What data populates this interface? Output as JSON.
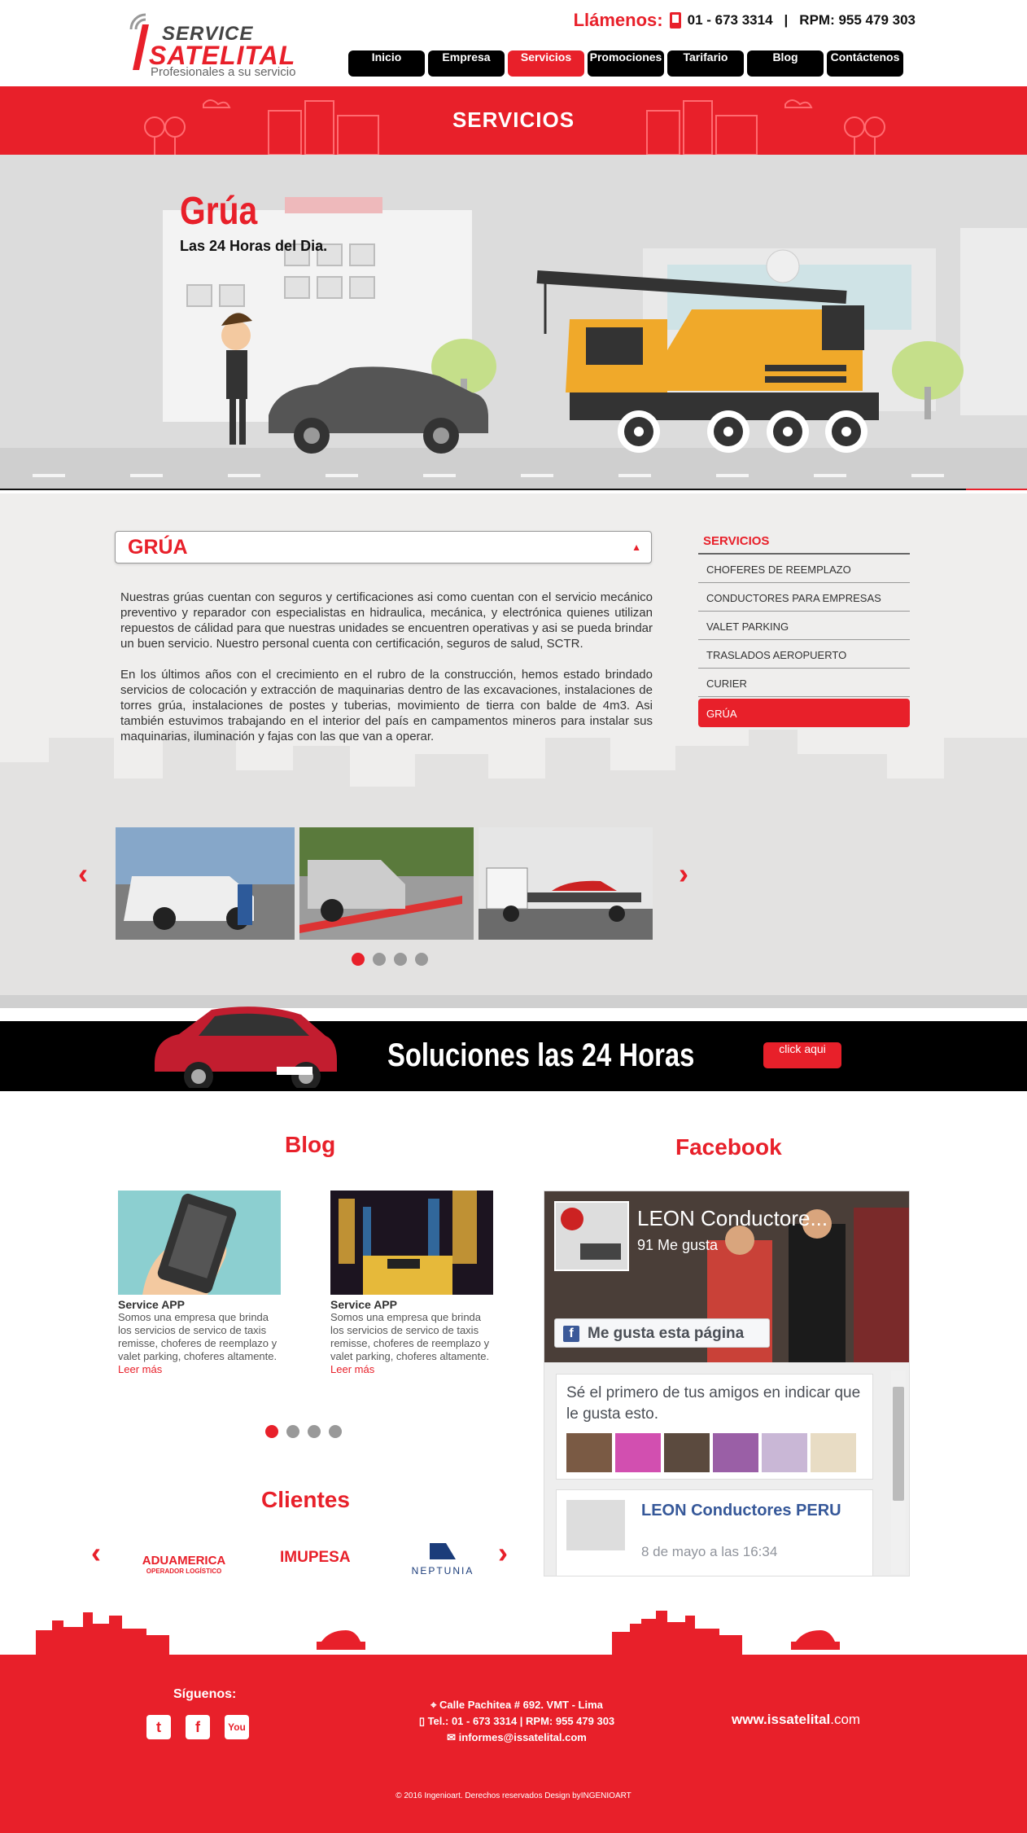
{
  "header": {
    "logo_top": "SERVICE",
    "logo_bottom": "SATELITAL",
    "logo_tagline": "Profesionales a su servicio",
    "call_label": "Llámenos:",
    "phone": "01 - 673 3314",
    "separator": "|",
    "rpm": "RPM: 955 479 303"
  },
  "nav": [
    {
      "label": "Inicio",
      "active": false
    },
    {
      "label": "Empresa",
      "active": false
    },
    {
      "label": "Servicios",
      "active": true
    },
    {
      "label": "Promociones",
      "active": false
    },
    {
      "label": "Tarifario",
      "active": false
    },
    {
      "label": "Blog",
      "active": false
    },
    {
      "label": "Contáctenos",
      "active": false
    }
  ],
  "banner": {
    "title": "SERVICIOS"
  },
  "hero": {
    "title": "Grúa",
    "subtitle": "Las 24 Horas del Dia."
  },
  "service": {
    "title": "GRÚA",
    "arrow": "▲",
    "paragraphs": [
      "Nuestras grúas cuentan con seguros y certificaciones asi como cuentan con  el servicio mecánico preventivo y reparador con especialistas en hidraulica, mecánica, y electrónica quienes utilizan repuestos de cálidad para que nuestras unidades se encuentren operativas y asi se pueda brindar un buen servicio. Nuestro personal cuenta con certificación, seguros de salud, SCTR.",
      "En los últimos años con el crecimiento en el rubro de la construcción, hemos estado brindado servicios de colocación y extracción de maquinarias dentro de las excavaciones, instalaciones de torres grúa, instalaciones de postes y tuberias, movimiento de tierra con balde de 4m3. Asi también estuvimos trabajando en el interior del país en campamentos mineros para instalar sus maquinarias, iluminación y fajas con las que van a operar."
    ],
    "gallery_prev": "‹",
    "gallery_next": "›",
    "gallery_dots": 4,
    "gallery_active": 0
  },
  "sidebar": {
    "title": "SERVICIOS",
    "items": [
      {
        "label": "CHOFERES DE REEMPLAZO",
        "active": false
      },
      {
        "label": "CONDUCTORES PARA EMPRESAS",
        "active": false
      },
      {
        "label": "VALET PARKING",
        "active": false
      },
      {
        "label": "TRASLADOS AEROPUERTO",
        "active": false
      },
      {
        "label": "CURIER",
        "active": false
      },
      {
        "label": "GRÚA",
        "active": true
      }
    ]
  },
  "cta": {
    "text": "Soluciones las 24 Horas",
    "button": "click aqui"
  },
  "blog": {
    "title": "Blog",
    "posts": [
      {
        "title": "Service APP",
        "body": "Somos una empresa que brinda los servicios de servico de taxis remisse, choferes de reemplazo y valet parking, choferes altamente.",
        "more": "Leer más"
      },
      {
        "title": "Service APP",
        "body": "Somos una empresa que brinda los servicios de servico de taxis remisse, choferes de reemplazo y valet parking, choferes altamente.",
        "more": "Leer más"
      }
    ]
  },
  "clients": {
    "title": "Clientes",
    "logos": [
      {
        "name": "ADUAMERICA",
        "tag": "OPERADOR LOGÍSTICO"
      },
      {
        "name": "IMUPESA"
      },
      {
        "name": "NEPTUNIA"
      }
    ],
    "prev": "‹",
    "next": "›"
  },
  "facebook": {
    "title": "Facebook",
    "page_name": "LEON Conductore...",
    "likes": "91 Me gusta",
    "like_button": "Me gusta esta página",
    "first_friend": "Sé el primero de tus amigos en indicar que le gusta esto.",
    "post_name": "LEON Conductores PERU",
    "post_date": "8 de mayo a las 16:34"
  },
  "footer": {
    "follow": "Síguenos:",
    "address": "Calle Pachitea # 692. VMT - Lima",
    "phones": "Tel.: 01 - 673 3314   |   RPM: 955 479 303",
    "email": "informes@issatelital.com",
    "site_prefix": "www.issatelital",
    "site_suffix": ".com",
    "copyright": "© 2016 Ingenioart. Derechos reservados  Design byINGENIOART"
  },
  "colors": {
    "accent": "#e8202a",
    "dark": "#000000",
    "bg": "#efeeed"
  }
}
